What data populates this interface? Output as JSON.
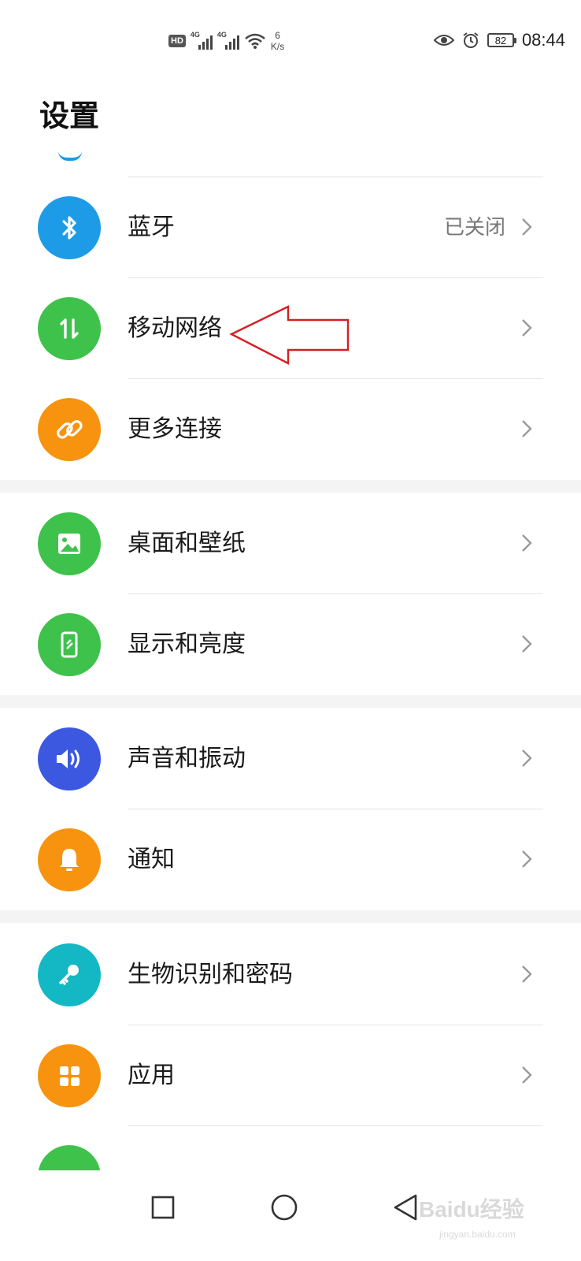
{
  "status_bar": {
    "hd_label": "HD",
    "signal1_label": "4G",
    "signal2_label": "4G",
    "speed_value": "6",
    "speed_unit": "K/s",
    "battery_level": "82",
    "time": "08:44"
  },
  "page_title": "设置",
  "groups": [
    {
      "items": [
        {
          "label": "蓝牙",
          "value": "已关闭",
          "icon": "bluetooth-icon",
          "color": "#1e9be6"
        },
        {
          "label": "移动网络",
          "value": "",
          "icon": "mobile-data-icon",
          "color": "#3ec24b"
        },
        {
          "label": "更多连接",
          "value": "",
          "icon": "link-icon",
          "color": "#f7930f"
        }
      ]
    },
    {
      "items": [
        {
          "label": "桌面和壁纸",
          "value": "",
          "icon": "wallpaper-icon",
          "color": "#3ec24b"
        },
        {
          "label": "显示和亮度",
          "value": "",
          "icon": "display-icon",
          "color": "#3ec24b"
        }
      ]
    },
    {
      "items": [
        {
          "label": "声音和振动",
          "value": "",
          "icon": "speaker-icon",
          "color": "#3d58e0"
        },
        {
          "label": "通知",
          "value": "",
          "icon": "bell-icon",
          "color": "#f7930f"
        }
      ]
    },
    {
      "items": [
        {
          "label": "生物识别和密码",
          "value": "",
          "icon": "key-icon",
          "color": "#14b8c4"
        },
        {
          "label": "应用",
          "value": "",
          "icon": "apps-icon",
          "color": "#f7930f"
        }
      ]
    }
  ],
  "nav_bar": {
    "buttons": [
      "recents-button",
      "home-button",
      "back-button"
    ]
  },
  "watermark_text": "Baidu经验",
  "watermark_url": "jingyan.baidu.com",
  "annotation": "red-arrow-pointing-to-mobile-network"
}
